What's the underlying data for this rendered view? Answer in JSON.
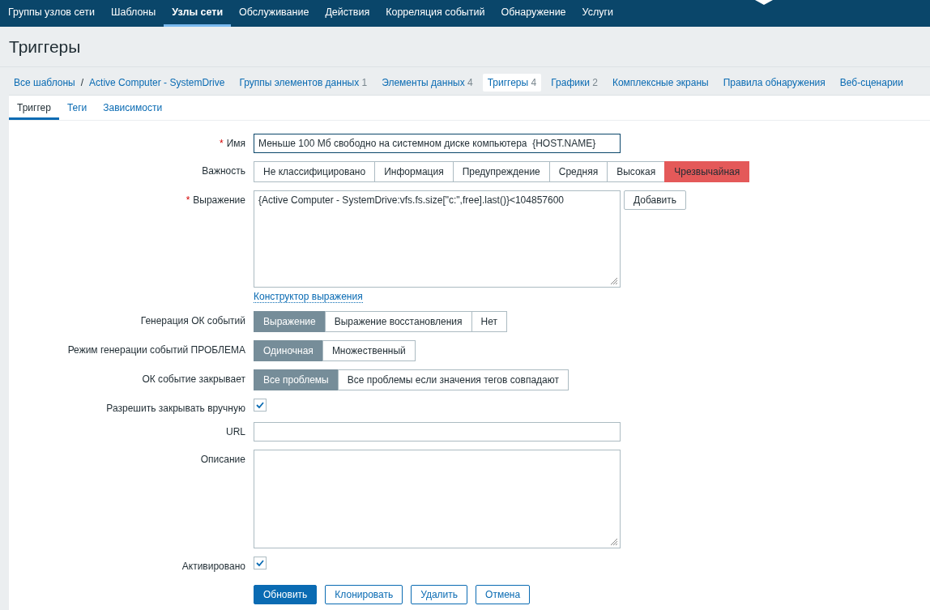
{
  "top_menu": [
    {
      "label": "Группы узлов сети",
      "selected": false
    },
    {
      "label": "Шаблоны",
      "selected": false
    },
    {
      "label": "Узлы сети",
      "selected": true
    },
    {
      "label": "Обслуживание",
      "selected": false
    },
    {
      "label": "Действия",
      "selected": false
    },
    {
      "label": "Корреляция событий",
      "selected": false
    },
    {
      "label": "Обнаружение",
      "selected": false
    },
    {
      "label": "Услуги",
      "selected": false
    }
  ],
  "page_title": "Триггеры",
  "breadcrumbs": [
    "Все шаблоны",
    "Active Computer - SystemDrive"
  ],
  "breadcrumb_separator": "/",
  "required_mark": "*",
  "nav_tabs": [
    {
      "label": "Группы элементов данных",
      "count": "1",
      "selected": false
    },
    {
      "label": "Элементы данных",
      "count": "4",
      "selected": false
    },
    {
      "label": "Триггеры",
      "count": "4",
      "selected": true
    },
    {
      "label": "Графики",
      "count": "2",
      "selected": false
    },
    {
      "label": "Комплексные экраны",
      "selected": false
    },
    {
      "label": "Правила обнаружения",
      "selected": false
    },
    {
      "label": "Веб-сценарии",
      "selected": false
    }
  ],
  "form_tabs": [
    {
      "label": "Триггер",
      "selected": true
    },
    {
      "label": "Теги",
      "selected": false
    },
    {
      "label": "Зависимости",
      "selected": false
    }
  ],
  "fields": [
    {
      "kind": "text",
      "label": "Имя",
      "required": true,
      "value": "Меньше 100 Мб свободно на системном диске компьютера  {HOST.NAME}"
    },
    {
      "kind": "severity",
      "label": "Важность",
      "options": [
        {
          "label": "Не классифицировано",
          "selected": false
        },
        {
          "label": "Информация",
          "selected": false
        },
        {
          "label": "Предупреждение",
          "selected": false
        },
        {
          "label": "Средняя",
          "selected": false
        },
        {
          "label": "Высокая",
          "selected": false
        },
        {
          "label": "Чрезвычайная",
          "selected": true
        }
      ]
    },
    {
      "kind": "expression",
      "label": "Выражение",
      "required": true,
      "value": "{Active Computer - SystemDrive:vfs.fs.size[\"c:\",free].last()}<104857600",
      "button": "Добавить",
      "link": "Конструктор выражения"
    },
    {
      "kind": "segmented",
      "label": "Генерация ОК событий",
      "options": [
        {
          "label": "Выражение",
          "selected": true
        },
        {
          "label": "Выражение восстановления",
          "selected": false
        },
        {
          "label": "Нет",
          "selected": false
        }
      ]
    },
    {
      "kind": "segmented",
      "label": "Режим генерации событий ПРОБЛЕМА",
      "options": [
        {
          "label": "Одиночная",
          "selected": true
        },
        {
          "label": "Множественный",
          "selected": false
        }
      ]
    },
    {
      "kind": "segmented",
      "label": "ОК событие закрывает",
      "options": [
        {
          "label": "Все проблемы",
          "selected": true
        },
        {
          "label": "Все проблемы если значения тегов совпадают",
          "selected": false
        }
      ]
    },
    {
      "kind": "checkbox",
      "label": "Разрешить закрывать вручную",
      "checked": true
    },
    {
      "kind": "text",
      "label": "URL",
      "required": false
    },
    {
      "kind": "textarea",
      "label": "Описание",
      "required": false
    },
    {
      "kind": "checkbox",
      "label": "Активировано",
      "checked": true
    }
  ],
  "buttons": [
    {
      "label": "Обновить",
      "primary": true
    },
    {
      "label": "Клонировать",
      "primary": false
    },
    {
      "label": "Удалить",
      "primary": false
    },
    {
      "label": "Отмена",
      "primary": false
    }
  ]
}
